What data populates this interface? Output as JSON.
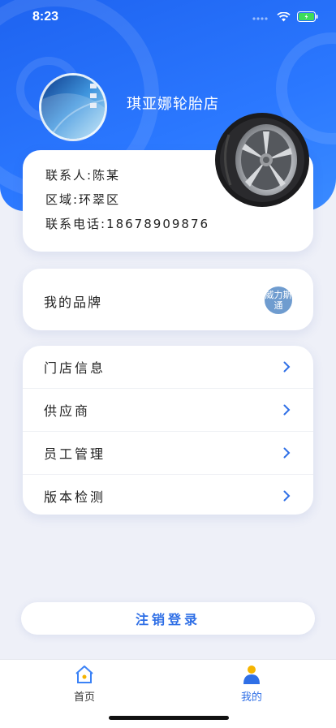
{
  "status_bar": {
    "time": "8:23"
  },
  "profile": {
    "store_name": "琪亚娜轮胎店",
    "contact": "联系人:陈某",
    "region": "区域:环翠区",
    "phone": "联系电话:18678909876"
  },
  "brand": {
    "label": "我的品牌",
    "logo_text": "威力斯通"
  },
  "menu": [
    {
      "label": "门店信息"
    },
    {
      "label": "供应商"
    },
    {
      "label": "员工管理"
    },
    {
      "label": "版本检测"
    }
  ],
  "logout_label": "注销登录",
  "tabbar": {
    "items": [
      {
        "label": "首页",
        "active": false
      },
      {
        "label": "我的",
        "active": true
      }
    ]
  },
  "colors": {
    "accent": "#2f6fe6",
    "hero": "#1e63f0",
    "background": "#eef0f8"
  }
}
